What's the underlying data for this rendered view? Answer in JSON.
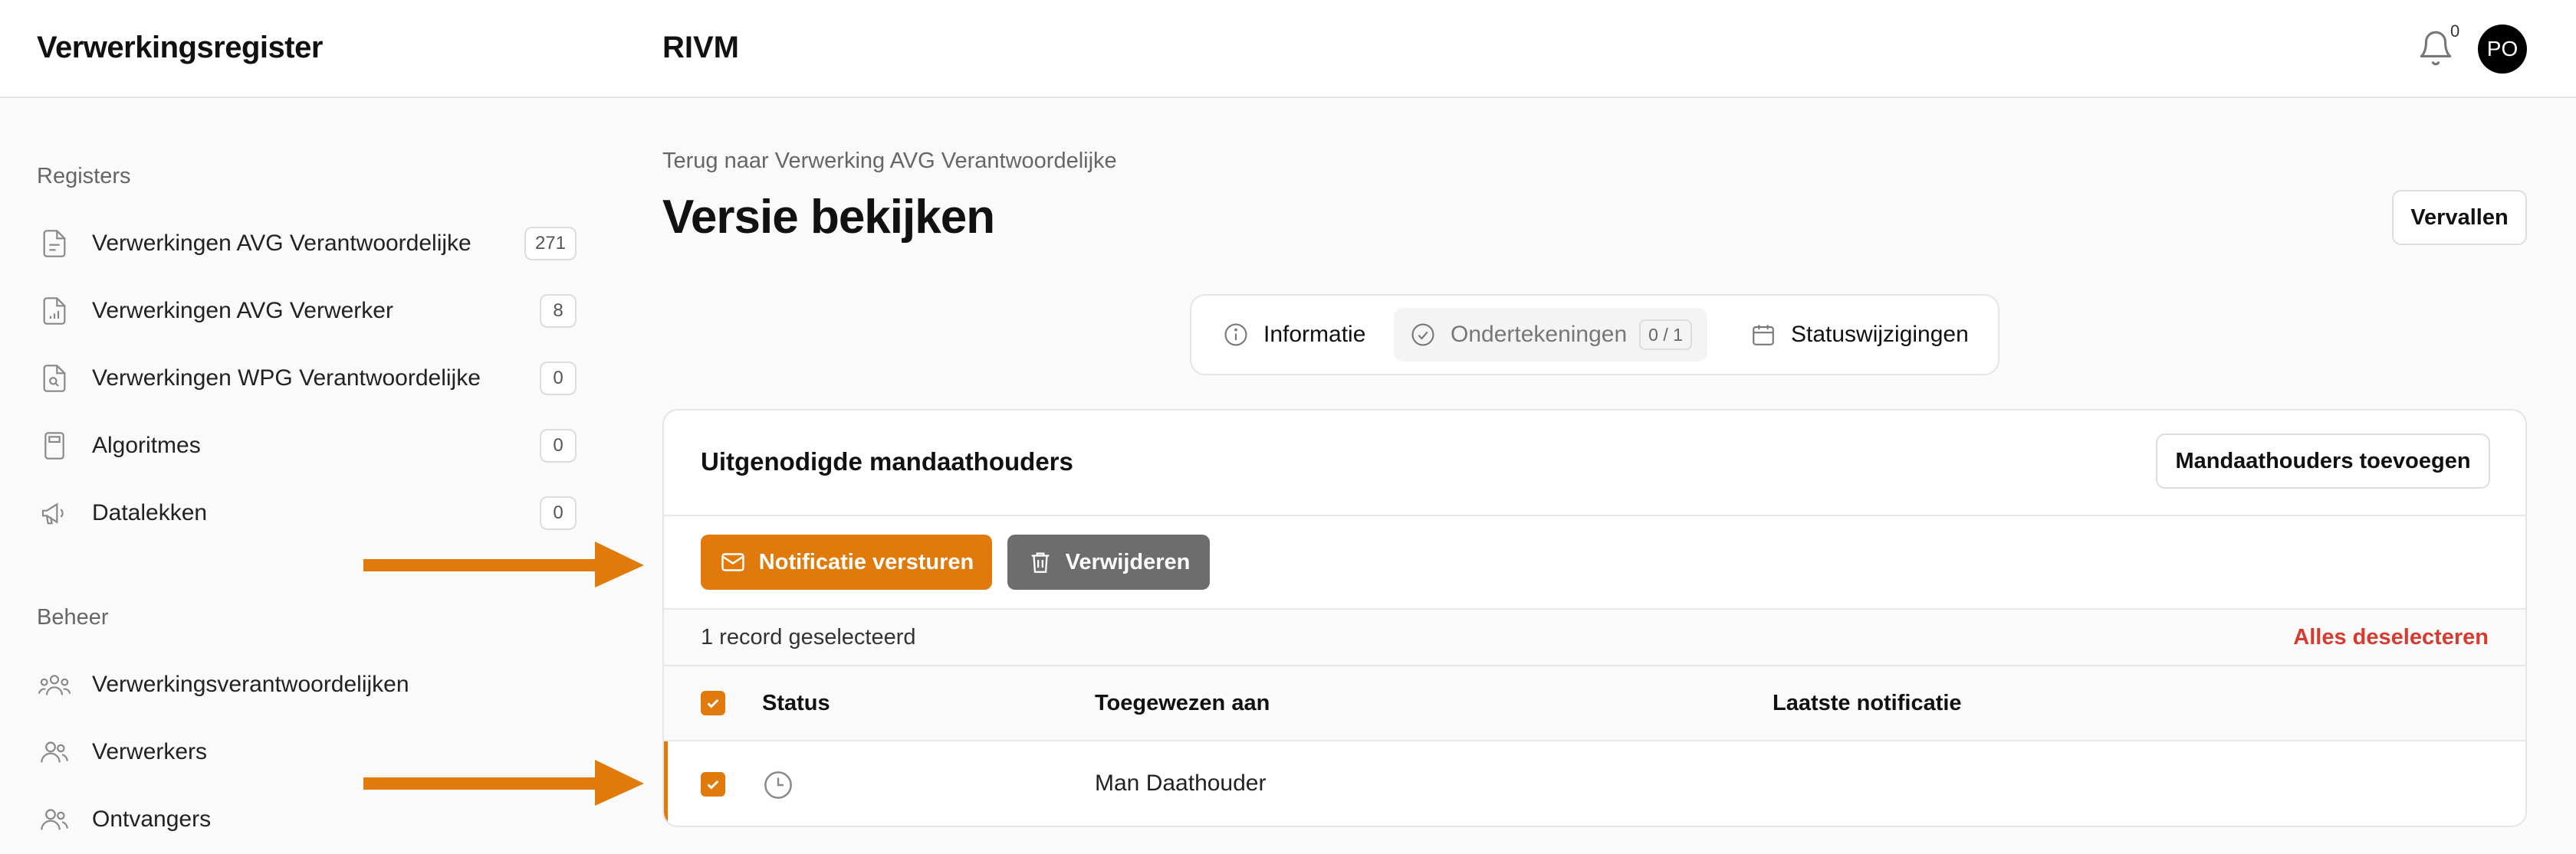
{
  "header": {
    "app_title": "Verwerkingsregister",
    "org_name": "RIVM",
    "notification_count": "0",
    "user_initials": "PO"
  },
  "sidebar": {
    "registers_title": "Registers",
    "registers": [
      {
        "label": "Verwerkingen AVG Verantwoordelijke",
        "count": "271",
        "icon": "document-icon"
      },
      {
        "label": "Verwerkingen AVG Verwerker",
        "count": "8",
        "icon": "document-chart-icon"
      },
      {
        "label": "Verwerkingen WPG Verantwoordelijke",
        "count": "0",
        "icon": "document-search-icon"
      },
      {
        "label": "Algoritmes",
        "count": "0",
        "icon": "calculator-icon"
      },
      {
        "label": "Datalekken",
        "count": "0",
        "icon": "megaphone-icon"
      }
    ],
    "beheer_title": "Beheer",
    "beheer": [
      {
        "label": "Verwerkingsverantwoordelijken",
        "icon": "group-icon"
      },
      {
        "label": "Verwerkers",
        "icon": "users-icon"
      },
      {
        "label": "Ontvangers",
        "icon": "users-icon"
      }
    ]
  },
  "main": {
    "breadcrumb": "Terug naar Verwerking AVG Verantwoordelijke",
    "title": "Versie bekijken",
    "expire_button": "Vervallen",
    "tabs": [
      {
        "label": "Informatie",
        "icon": "info-icon"
      },
      {
        "label": "Ondertekeningen",
        "badge": "0 / 1",
        "icon": "check-circle-icon"
      },
      {
        "label": "Statuswijzigingen",
        "icon": "calendar-icon"
      }
    ]
  },
  "card": {
    "title": "Uitgenodigde mandaathouders",
    "add_button": "Mandaathouders toevoegen",
    "notify_button": "Notificatie versturen",
    "delete_button": "Verwijderen",
    "selection_text": "1 record geselecteerd",
    "deselect_all": "Alles deselecteren",
    "columns": [
      "Status",
      "Toegewezen aan",
      "Laatste notificatie"
    ],
    "rows": [
      {
        "status_icon": "clock-icon",
        "assigned_to": "Man Daathouder",
        "last_notification": "",
        "selected": true
      }
    ]
  },
  "colors": {
    "accent": "#e07a0a",
    "danger": "#d63b2f",
    "secondary_button": "#6d6d6d"
  }
}
